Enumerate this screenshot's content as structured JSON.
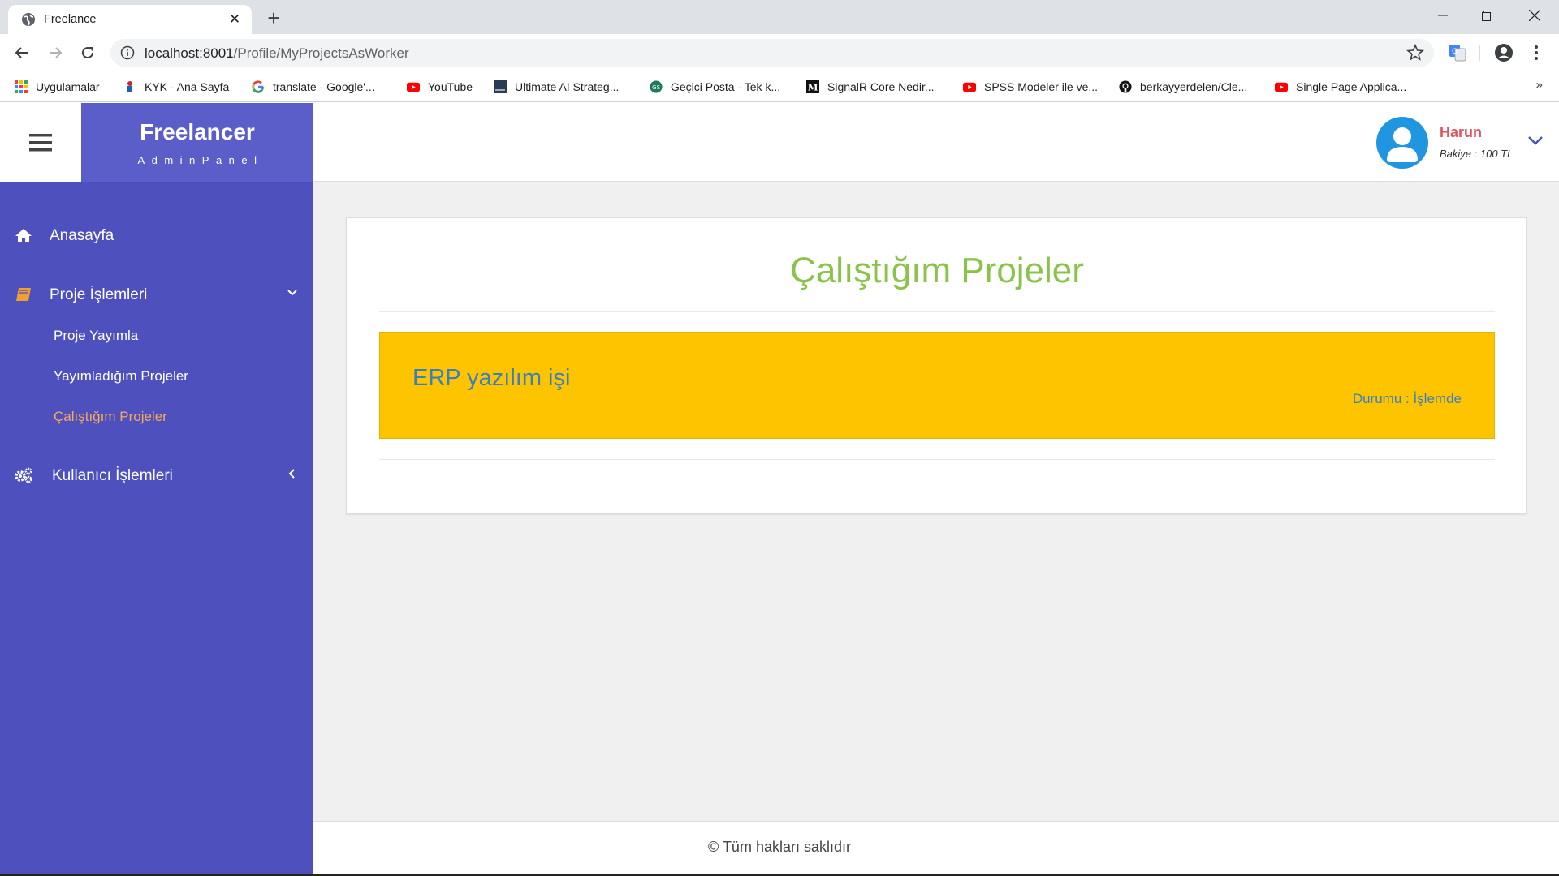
{
  "browser": {
    "tab_title": "Freelance",
    "url_host": "localhost:8001",
    "url_path": "/Profile/MyProjectsAsWorker",
    "bookmarks": [
      {
        "label": "Uygulamalar",
        "icon": "apps-grid-icon"
      },
      {
        "label": "KYK - Ana Sayfa",
        "icon": "kyk-icon"
      },
      {
        "label": "translate - Google'...",
        "icon": "google-icon"
      },
      {
        "label": "YouTube",
        "icon": "youtube-icon"
      },
      {
        "label": "Ultimate AI Strateg...",
        "icon": "page-icon"
      },
      {
        "label": "Geçici Posta - Tek k...",
        "icon": "mail-icon"
      },
      {
        "label": "SignalR Core Nedir...",
        "icon": "medium-icon"
      },
      {
        "label": "SPSS Modeler ile ve...",
        "icon": "youtube-icon"
      },
      {
        "label": "berkayyerdelen/Cle...",
        "icon": "github-icon"
      },
      {
        "label": "Single Page Applica...",
        "icon": "youtube-icon"
      }
    ],
    "more_label": "»"
  },
  "sidebar": {
    "brand_title": "Freelancer",
    "brand_subtitle": "AdminPanel",
    "menu": {
      "home": "Anasayfa",
      "projects": "Proje İşlemleri",
      "users": "Kullanıcı İşlemleri"
    },
    "submenu": {
      "publish": "Proje Yayımla",
      "published": "Yayımladığım Projeler",
      "working": "Çalıştığım Projeler"
    }
  },
  "header": {
    "user_name": "Harun",
    "balance": "Bakiye : 100 TL"
  },
  "main": {
    "title": "Çalıştığım Projeler",
    "projects": [
      {
        "name": "ERP yazılım işi",
        "status": "Durumu : İşlemde"
      }
    ]
  },
  "footer": {
    "text": "© Tüm hakları saklıdır"
  },
  "colors": {
    "sidebar": "#4e50bd",
    "brand": "#5b5dc9",
    "title": "#8bc34a",
    "project_card": "#ffc400",
    "project_text": "#3b7fc2",
    "active_submenu": "#f8a95a",
    "user_name": "#e0525e",
    "avatar": "#2196e0"
  }
}
